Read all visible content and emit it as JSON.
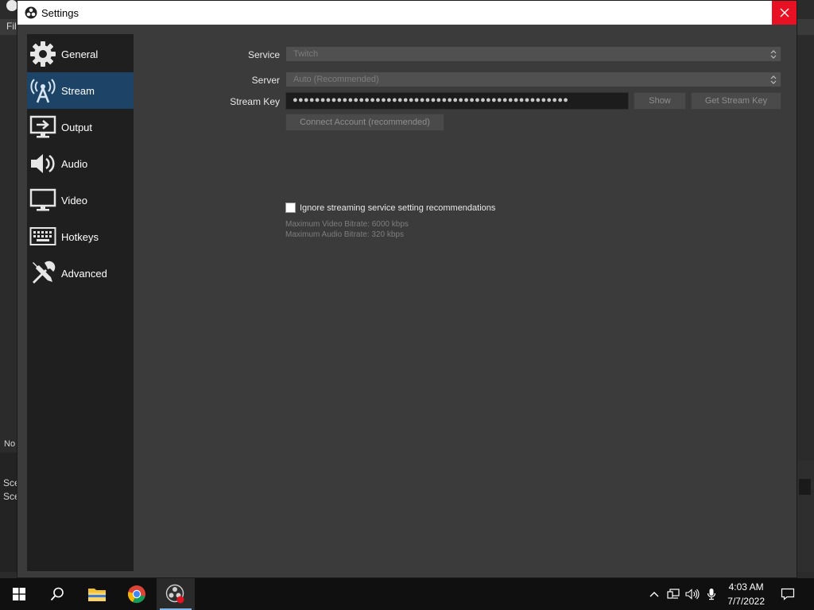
{
  "background_window": {
    "menu_fragment": "Fil",
    "status_fragment": "No",
    "scene_fragment_1": "Sce",
    "scene_fragment_2": "Sce"
  },
  "dialog": {
    "title": "Settings",
    "close_icon": "close-icon"
  },
  "sidebar": {
    "items": [
      {
        "label": "General",
        "icon": "gear-icon",
        "active": false
      },
      {
        "label": "Stream",
        "icon": "antenna-icon",
        "active": true
      },
      {
        "label": "Output",
        "icon": "output-monitor-icon",
        "active": false
      },
      {
        "label": "Audio",
        "icon": "speaker-icon",
        "active": false
      },
      {
        "label": "Video",
        "icon": "monitor-icon",
        "active": false
      },
      {
        "label": "Hotkeys",
        "icon": "keyboard-icon",
        "active": false
      },
      {
        "label": "Advanced",
        "icon": "tools-icon",
        "active": false
      }
    ]
  },
  "stream": {
    "service_label": "Service",
    "service_value": "Twitch",
    "server_label": "Server",
    "server_value": "Auto (Recommended)",
    "stream_key_label": "Stream Key",
    "stream_key_value": "●●●●●●●●●●●●●●●●●●●●●●●●●●●●●●●●●●●●●●●●●●●●●●●●●●",
    "show_button": "Show",
    "get_key_button": "Get Stream Key",
    "connect_button": "Connect Account (recommended)",
    "ignore_checkbox_label": "Ignore streaming service setting recommendations",
    "ignore_checked": false,
    "max_video_bitrate": "Maximum Video Bitrate: 6000 kbps",
    "max_audio_bitrate": "Maximum Audio Bitrate: 320 kbps"
  },
  "taskbar": {
    "time": "4:03 AM",
    "date": "7/7/2022",
    "apps": [
      "windows-start-icon",
      "search-icon",
      "file-explorer-icon",
      "chrome-icon",
      "obs-icon"
    ],
    "tray": [
      "chevron-up-icon",
      "network-icon",
      "volume-icon",
      "microphone-icon",
      "notification-icon"
    ]
  },
  "colors": {
    "accent_selected": "#1d4466",
    "close_red": "#e81123",
    "dialog_bg": "#3b3b3b",
    "sidebar_bg": "#1f1f1f"
  }
}
